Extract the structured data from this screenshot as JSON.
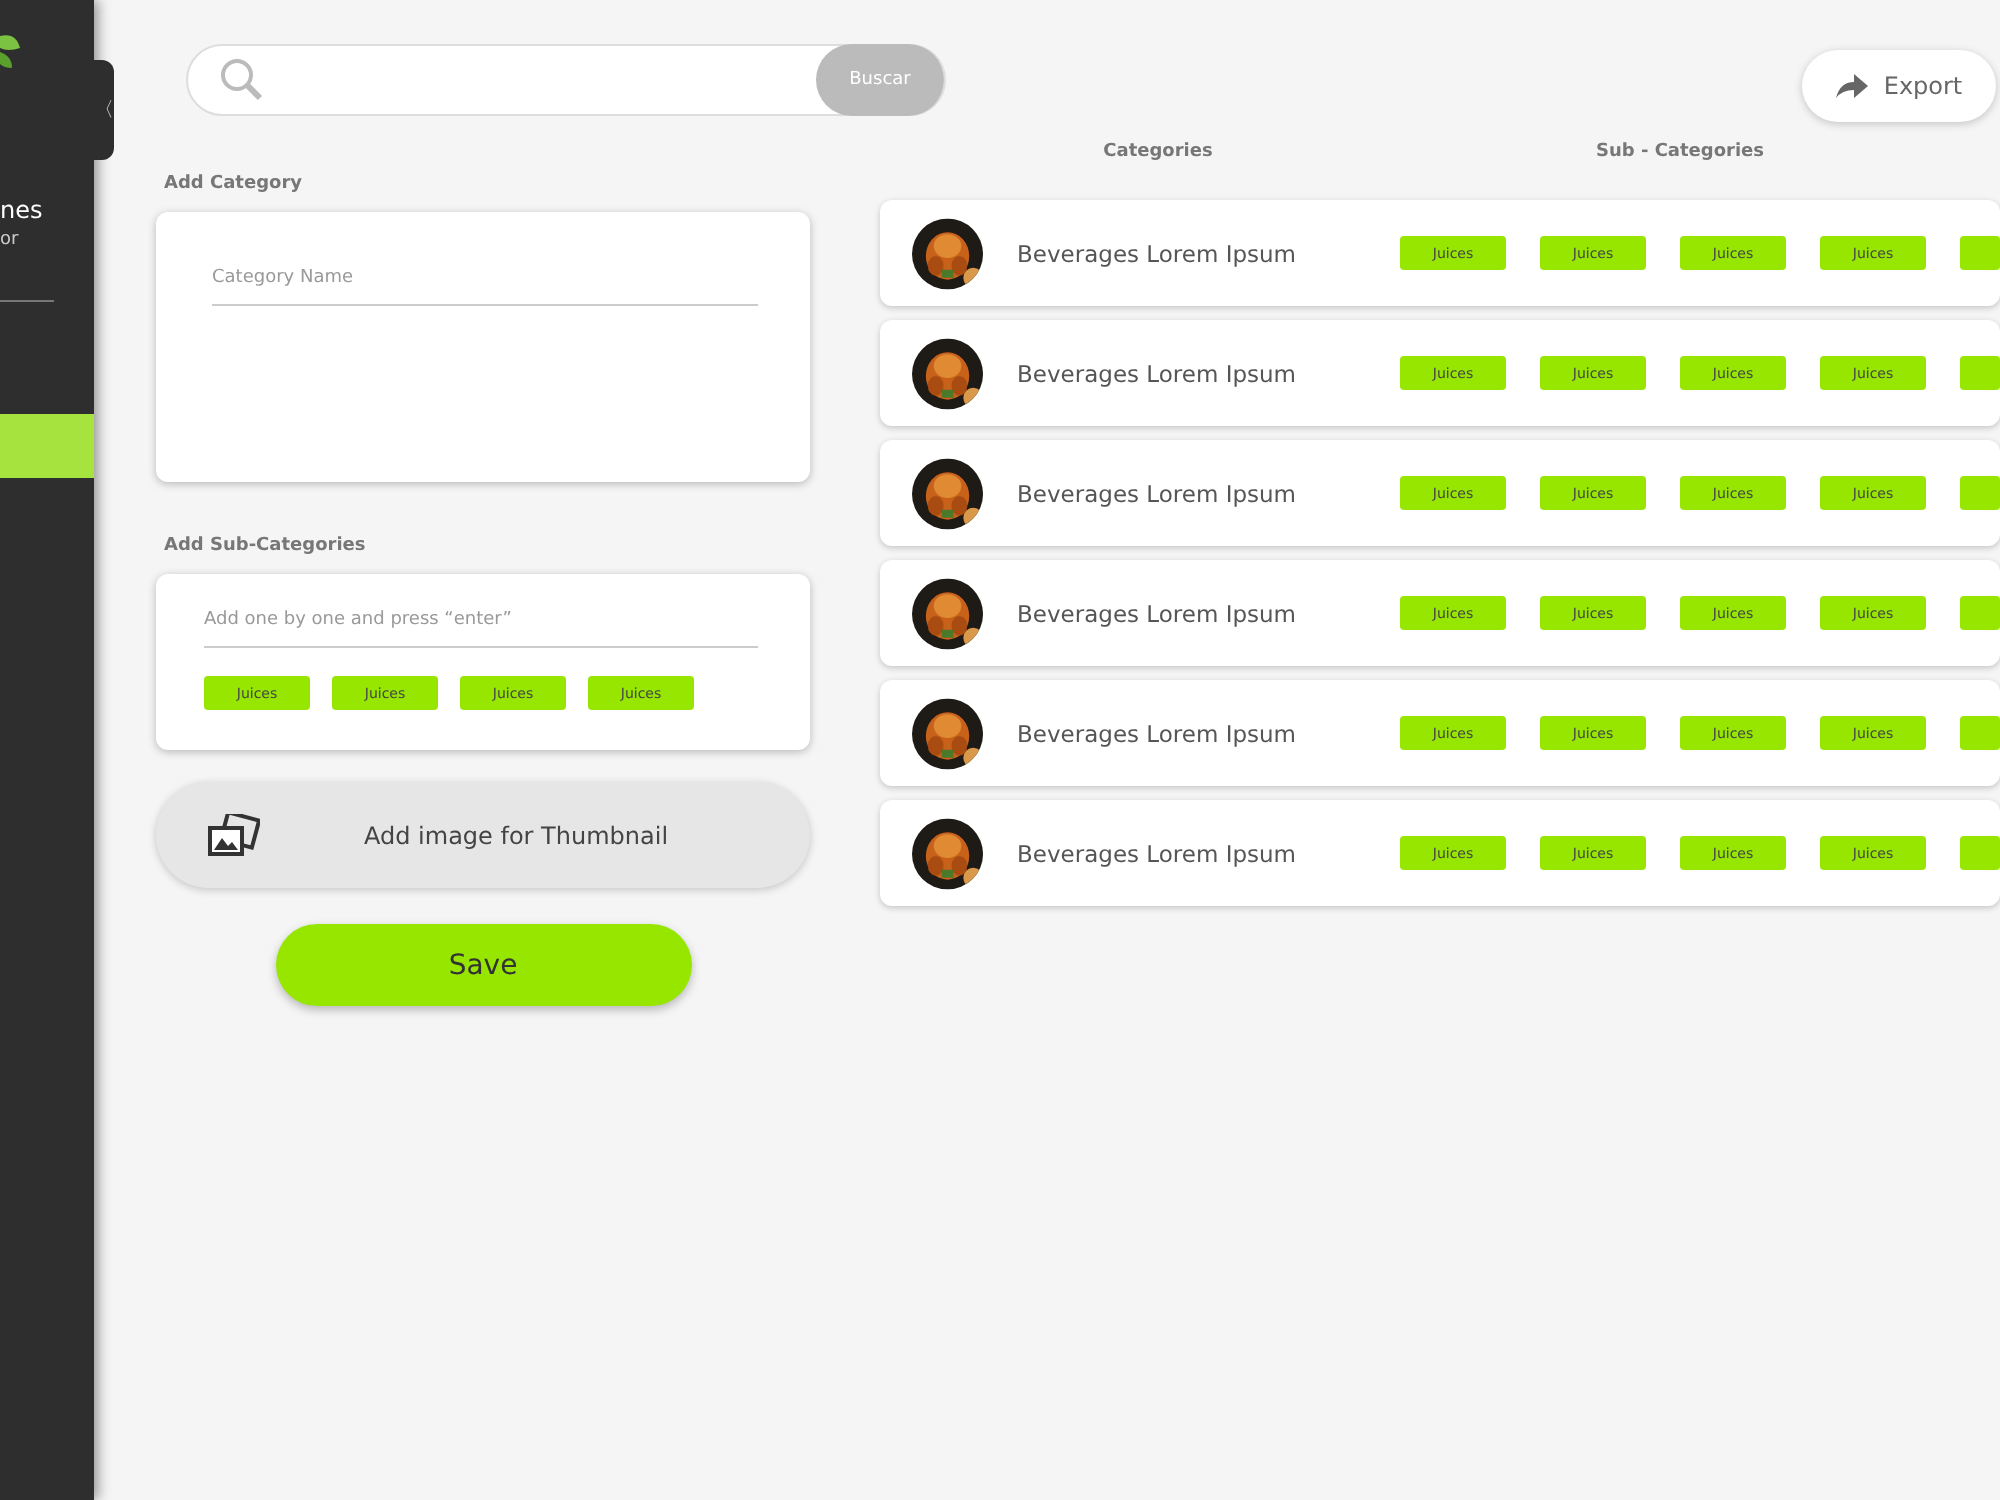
{
  "sidebar": {
    "collapse_toggle": "〈",
    "title_fragment": "nes",
    "subtitle_fragment": "or",
    "items": [
      {
        "selected": true
      }
    ]
  },
  "search": {
    "button": "Buscar"
  },
  "export_button": "Export",
  "add_category": {
    "heading": "Add Category",
    "placeholder": "Category Name"
  },
  "add_subcategories": {
    "heading": "Add Sub-Categories",
    "placeholder": "Add one by one and press “enter”",
    "tags": [
      "Juices",
      "Juices",
      "Juices",
      "Juices"
    ]
  },
  "thumbnail_button": "Add image for Thumbnail",
  "save_button": "Save",
  "table": {
    "columns": [
      "Categories",
      "Sub - Categories"
    ],
    "rows": [
      {
        "name": "Beverages Lorem Ipsum",
        "tags": [
          "Juices",
          "Juices",
          "Juices",
          "Juices"
        ]
      },
      {
        "name": "Beverages Lorem Ipsum",
        "tags": [
          "Juices",
          "Juices",
          "Juices",
          "Juices"
        ]
      },
      {
        "name": "Beverages Lorem Ipsum",
        "tags": [
          "Juices",
          "Juices",
          "Juices",
          "Juices"
        ]
      },
      {
        "name": "Beverages Lorem Ipsum",
        "tags": [
          "Juices",
          "Juices",
          "Juices",
          "Juices"
        ]
      },
      {
        "name": "Beverages Lorem Ipsum",
        "tags": [
          "Juices",
          "Juices",
          "Juices",
          "Juices"
        ]
      },
      {
        "name": "Beverages Lorem Ipsum",
        "tags": [
          "Juices",
          "Juices",
          "Juices",
          "Juices"
        ]
      }
    ]
  }
}
